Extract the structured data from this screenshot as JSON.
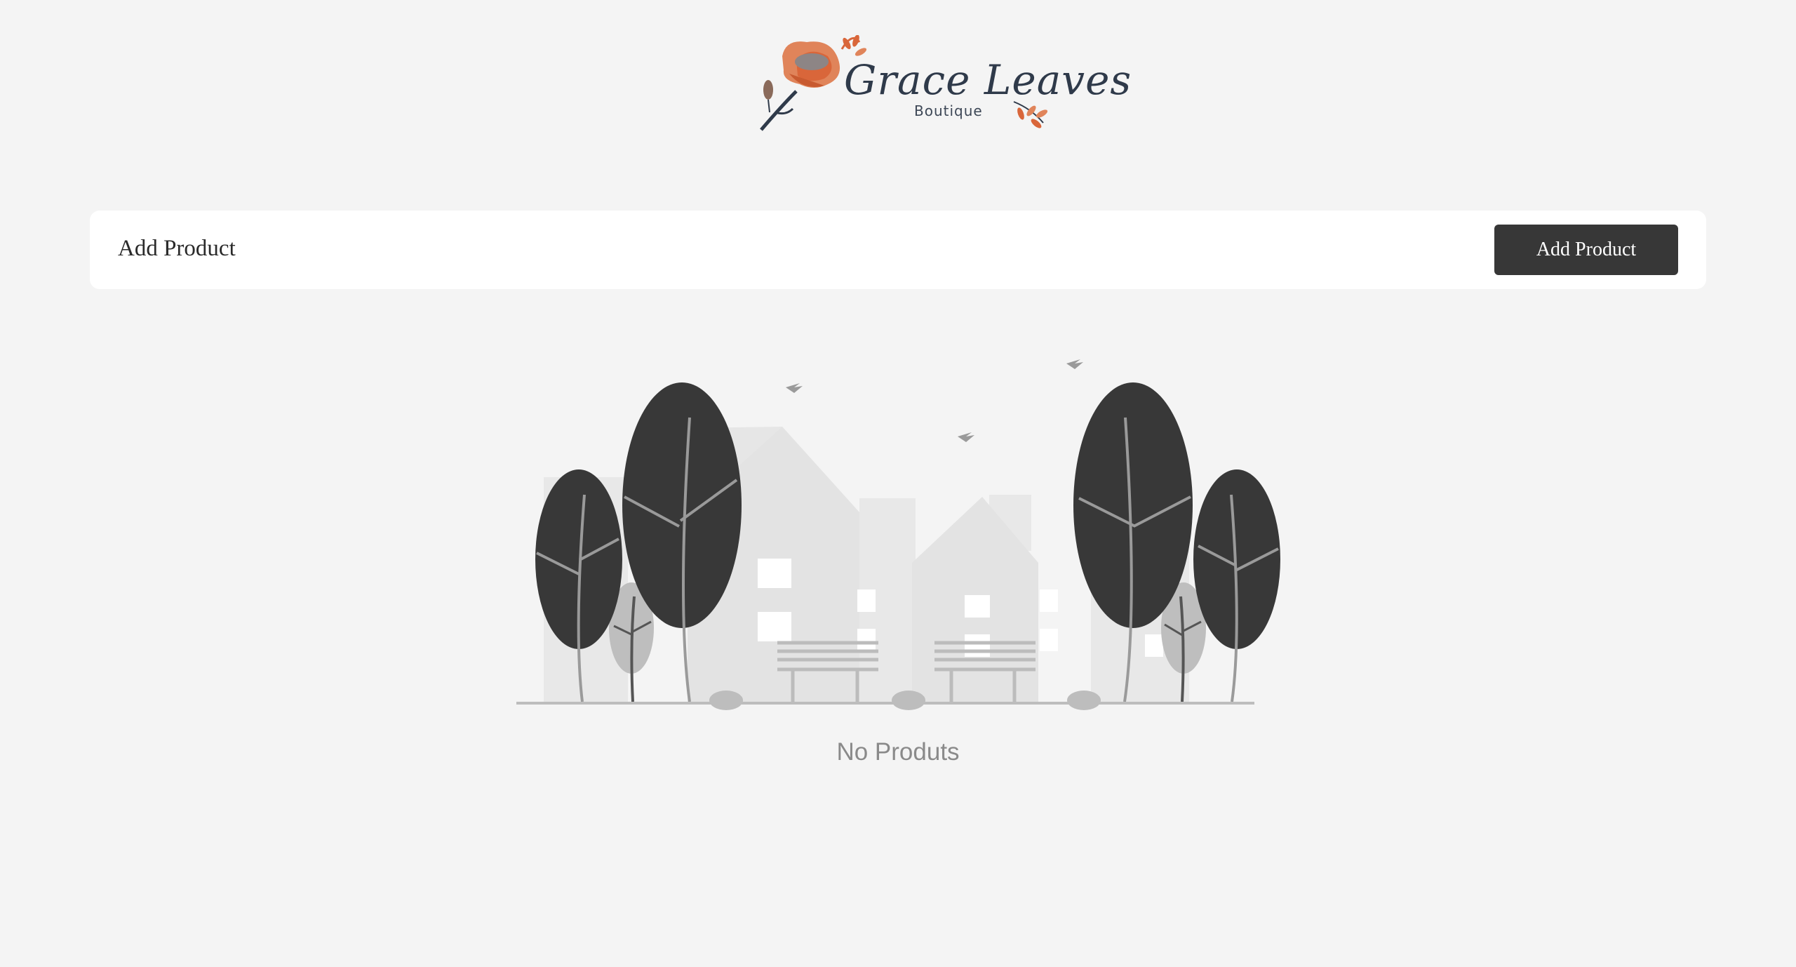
{
  "brand": {
    "name": "Grace Leaves",
    "tagline": "Boutique"
  },
  "toolbar": {
    "title": "Add Product",
    "add_button_label": "Add Product"
  },
  "empty_state": {
    "message": "No Produts"
  },
  "colors": {
    "background": "#f4f4f4",
    "card": "#ffffff",
    "button": "#373737",
    "button_text": "#ffffff",
    "logo_orange": "#d9663a",
    "logo_navy": "#2f3a4a",
    "tree_dark": "#383838",
    "building": "#e3e3e3"
  }
}
